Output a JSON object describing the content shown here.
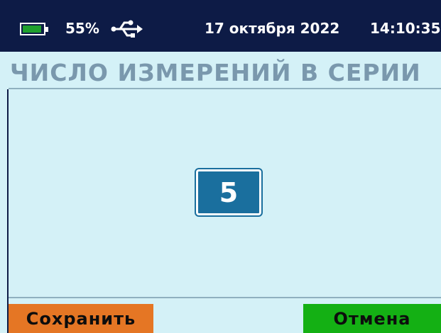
{
  "status": {
    "battery_percent_label": "55%",
    "battery_level": 0.55,
    "date": "17 октября 2022",
    "time": "14:10:35",
    "usb_icon": "usb-icon",
    "battery_icon": "battery-icon"
  },
  "screen": {
    "title": "ЧИСЛО ИЗМЕРЕНИЙ В СЕРИИ",
    "value": "5"
  },
  "buttons": {
    "save_label": "Сохранить",
    "cancel_label": "Отмена"
  },
  "colors": {
    "header_bg": "#0d1b46",
    "screen_bg": "#d4f1f7",
    "title": "#7a98ad",
    "value_box": "#1a6f9e",
    "save": "#e57624",
    "cancel": "#14b014",
    "battery_fill": "#1fa02d"
  }
}
